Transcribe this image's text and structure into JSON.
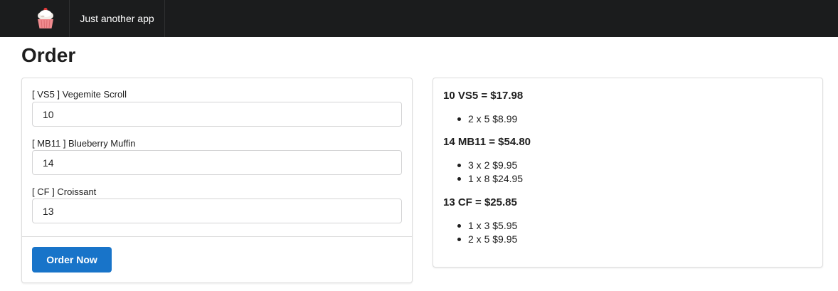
{
  "nav": {
    "logo_icon": "cupcake-icon",
    "app_name": "Just another app"
  },
  "page": {
    "title": "Order"
  },
  "form": {
    "fields": [
      {
        "label": "[ VS5 ] Vegemite Scroll",
        "value": "10"
      },
      {
        "label": "[ MB11 ] Blueberry Muffin",
        "value": "14"
      },
      {
        "label": "[ CF ] Croissant",
        "value": "13"
      }
    ],
    "submit_label": "Order Now"
  },
  "summary": {
    "items": [
      {
        "heading": "10 VS5 = $17.98",
        "lines": [
          "2 x 5 $8.99"
        ]
      },
      {
        "heading": "14 MB11 = $54.80",
        "lines": [
          "3 x 2 $9.95",
          "1 x 8 $24.95"
        ]
      },
      {
        "heading": "13 CF = $25.85",
        "lines": [
          "1 x 3 $5.95",
          "2 x 5 $9.95"
        ]
      }
    ]
  },
  "colors": {
    "navbar": "#1b1c1d",
    "primary_button": "#1874c9"
  }
}
